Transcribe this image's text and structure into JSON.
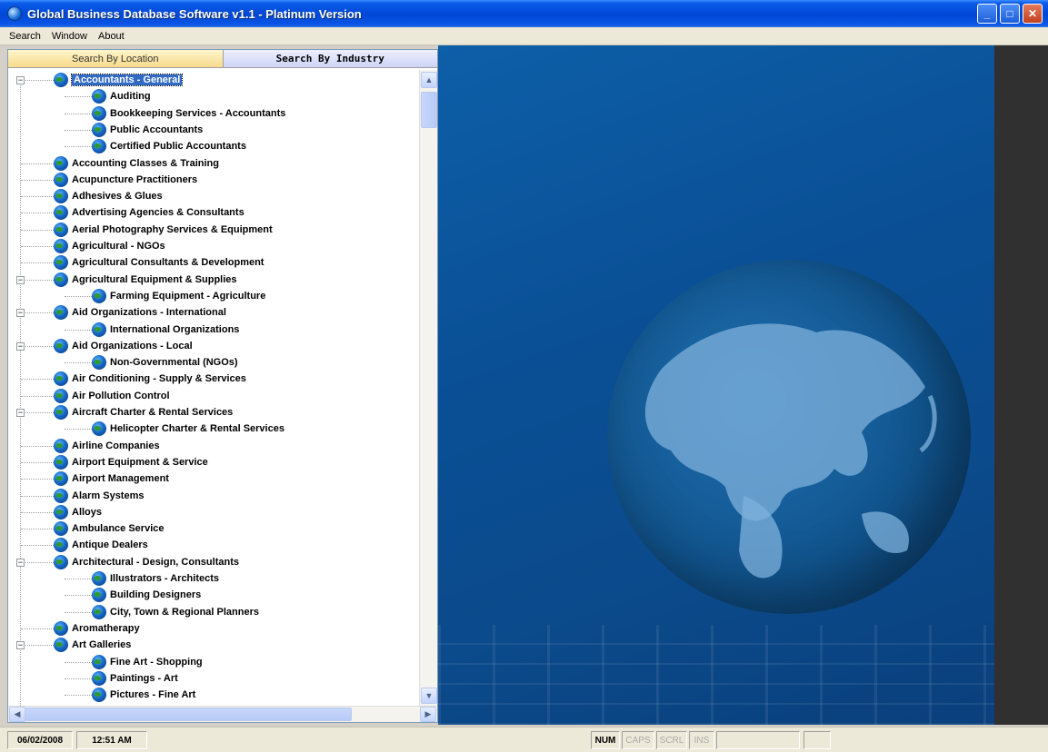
{
  "window": {
    "title": "Global Business Database Software v1.1 - Platinum Version"
  },
  "menu": [
    "Search",
    "Window",
    "About"
  ],
  "tabs": {
    "location": "Search By Location",
    "industry": "Search By Industry"
  },
  "tree": [
    {
      "label": "Accountants - General",
      "level": 0,
      "expander": "⊟",
      "selected": true
    },
    {
      "label": "Auditing",
      "level": 1
    },
    {
      "label": "Bookkeeping Services - Accountants",
      "level": 1
    },
    {
      "label": "Public Accountants",
      "level": 1
    },
    {
      "label": "Certified Public Accountants",
      "level": 1
    },
    {
      "label": "Accounting Classes & Training",
      "level": 0
    },
    {
      "label": "Acupuncture Practitioners",
      "level": 0
    },
    {
      "label": "Adhesives & Glues",
      "level": 0
    },
    {
      "label": "Advertising Agencies & Consultants",
      "level": 0
    },
    {
      "label": "Aerial Photography Services & Equipment",
      "level": 0
    },
    {
      "label": "Agricultural - NGOs",
      "level": 0
    },
    {
      "label": "Agricultural Consultants & Development",
      "level": 0
    },
    {
      "label": "Agricultural Equipment & Supplies",
      "level": 0,
      "expander": "⊟"
    },
    {
      "label": "Farming Equipment - Agriculture",
      "level": 1
    },
    {
      "label": "Aid Organizations - International",
      "level": 0,
      "expander": "⊟"
    },
    {
      "label": "International Organizations",
      "level": 1
    },
    {
      "label": "Aid Organizations - Local",
      "level": 0,
      "expander": "⊟"
    },
    {
      "label": "Non-Governmental (NGOs)",
      "level": 1
    },
    {
      "label": "Air Conditioning - Supply & Services",
      "level": 0
    },
    {
      "label": "Air Pollution Control",
      "level": 0
    },
    {
      "label": "Aircraft Charter & Rental Services",
      "level": 0,
      "expander": "⊟"
    },
    {
      "label": "Helicopter Charter & Rental Services",
      "level": 1
    },
    {
      "label": "Airline Companies",
      "level": 0
    },
    {
      "label": "Airport Equipment & Service",
      "level": 0
    },
    {
      "label": "Airport Management",
      "level": 0
    },
    {
      "label": "Alarm Systems",
      "level": 0
    },
    {
      "label": "Alloys",
      "level": 0
    },
    {
      "label": "Ambulance Service",
      "level": 0
    },
    {
      "label": "Antique Dealers",
      "level": 0
    },
    {
      "label": "Architectural - Design, Consultants",
      "level": 0,
      "expander": "⊟"
    },
    {
      "label": "Illustrators - Architects",
      "level": 1
    },
    {
      "label": "Building Designers",
      "level": 1
    },
    {
      "label": "City, Town & Regional Planners",
      "level": 1
    },
    {
      "label": "Aromatherapy",
      "level": 0
    },
    {
      "label": "Art Galleries",
      "level": 0,
      "expander": "⊟"
    },
    {
      "label": "Fine Art - Shopping",
      "level": 1
    },
    {
      "label": "Paintings - Art",
      "level": 1
    },
    {
      "label": "Pictures - Fine Art",
      "level": 1
    }
  ],
  "status": {
    "date": "06/02/2008",
    "time": "12:51 AM",
    "num": "NUM",
    "caps": "CAPS",
    "scrl": "SCRL",
    "ins": "INS"
  },
  "colors": {
    "titlebar": "#0047d6",
    "selection": "#316ac5",
    "right_pane": "#0b4a8b"
  }
}
